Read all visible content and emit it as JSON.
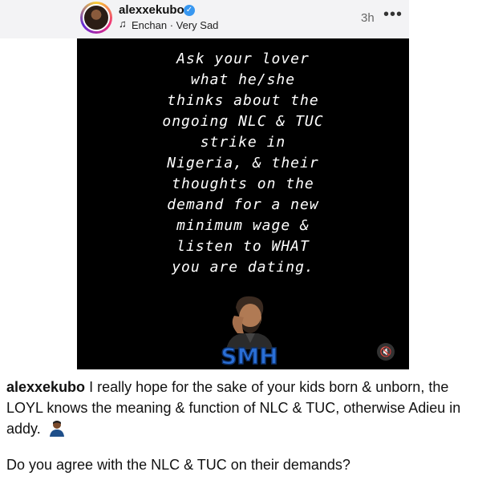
{
  "header": {
    "username": "alexxekubo",
    "music": "Enchan · Very Sad",
    "timestamp": "3h",
    "more_icon": "ellipsis-icon"
  },
  "post": {
    "lines": [
      "Ask your lover",
      "what he/she",
      "thinks about the",
      "ongoing NLC & TUC",
      "strike in",
      "Nigeria, & their",
      "thoughts on the",
      "demand for a new",
      "minimum wage &",
      "listen to WHAT",
      "you are dating."
    ],
    "sticker_text": "SMH"
  },
  "caption": {
    "username": "alexxekubo",
    "text": "I really hope for the sake of your kids born & unborn, the LOYL knows the meaning & function of NLC & TUC, otherwise Adieu in addy.",
    "question": "Do you agree with the NLC & TUC on their demands?"
  },
  "colors": {
    "verified": "#3897f0",
    "post_background": "#000000",
    "sticker_blue": "#2a6fd6"
  }
}
